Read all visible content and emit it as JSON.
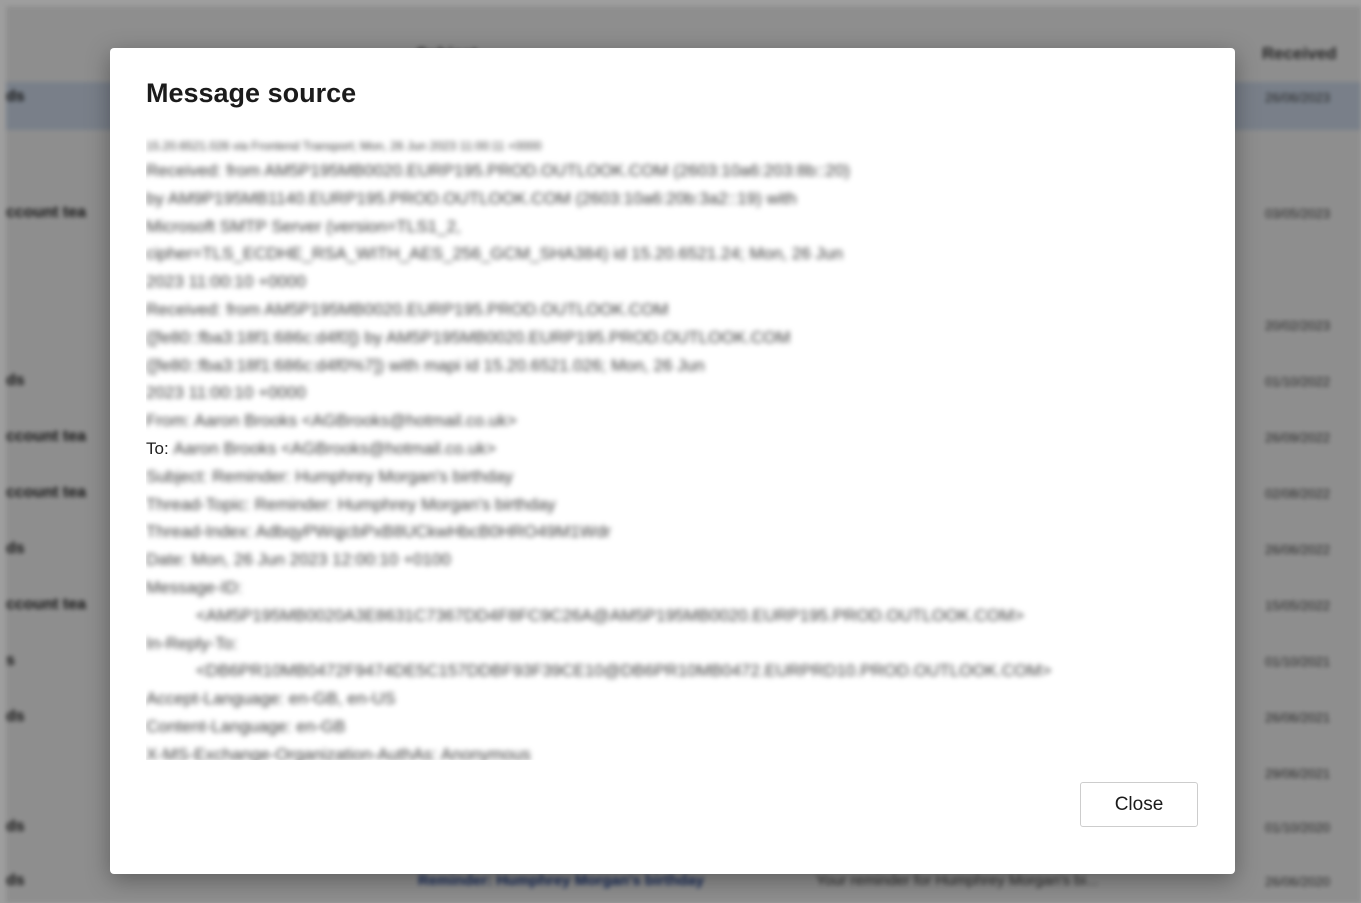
{
  "background": {
    "column_headers": [
      "Subject",
      "Received"
    ],
    "rows": [
      {
        "left": "ds",
        "date": "26/06/2023",
        "selected": true
      },
      {
        "left": "",
        "date": "",
        "selected": false
      },
      {
        "left": "ccount tea",
        "date": "03/05/2023",
        "selected": false
      },
      {
        "left": "",
        "date": "",
        "selected": false
      },
      {
        "left": "",
        "date": "20/02/2023",
        "selected": false
      },
      {
        "left": "ds",
        "date": "01/10/2022",
        "selected": false
      },
      {
        "left": "ccount tea",
        "date": "26/09/2022",
        "selected": false
      },
      {
        "left": "ccount tea",
        "date": "02/08/2022",
        "selected": false
      },
      {
        "left": "ds",
        "date": "26/06/2022",
        "selected": false
      },
      {
        "left": "ccount tea",
        "date": "15/05/2022",
        "selected": false
      },
      {
        "left": "s",
        "date": "01/10/2021",
        "selected": false
      },
      {
        "left": "ds",
        "date": "26/06/2021",
        "selected": false
      },
      {
        "left": "",
        "date": "29/06/2021",
        "selected": false
      },
      {
        "left": "ds",
        "date": "01/10/2020",
        "selected": false
      },
      {
        "left": "ds",
        "date": "26/06/2020",
        "selected": false
      }
    ],
    "bottom_subject": "Reminder: Humphrey Morgan's birthday",
    "bottom_preview": "Your reminder for Humphrey Morgan's bi..."
  },
  "dialog": {
    "title": "Message source",
    "close_label": "Close",
    "source_lines": [
      {
        "text": "15.20.6521.026 via Frontend Transport; Mon, 26 Jun 2023 11:00:11 +0000",
        "blur": true,
        "first": true
      },
      {
        "text": "Received: from AM5P195MB0020.EURP195.PROD.OUTLOOK.COM (2603:10a6:203:8b::20)",
        "blur": true
      },
      {
        "text": " by AM9P195MB1140.EURP195.PROD.OUTLOOK.COM (2603:10a6:20b:3a2::19) with",
        "blur": true
      },
      {
        "text": " Microsoft SMTP Server (version=TLS1_2,",
        "blur": true
      },
      {
        "text": " cipher=TLS_ECDHE_RSA_WITH_AES_256_GCM_SHA384) id 15.20.6521.24; Mon, 26 Jun",
        "blur": true
      },
      {
        "text": " 2023 11:00:10 +0000",
        "blur": true
      },
      {
        "text": "Received: from AM5P195MB0020.EURP195.PROD.OUTLOOK.COM",
        "blur": true
      },
      {
        "text": " ([fe80::fba3:18f1:686c:d4f0]) by AM5P195MB0020.EURP195.PROD.OUTLOOK.COM",
        "blur": true
      },
      {
        "text": " ([fe80::fba3:18f1:686c:d4f0%7]) with mapi id 15.20.6521.026; Mon, 26 Jun",
        "blur": true
      },
      {
        "text": " 2023 11:00:10 +0000",
        "blur": true
      },
      {
        "text": "From: Aaron Brooks <AGBrooks@hotmail.co.uk>",
        "blur": true
      },
      {
        "prefix": "To: ",
        "text": "Aaron Brooks <AGBrooks@hotmail.co.uk>",
        "blur": true
      },
      {
        "text": "Subject: Reminder: Humphrey Morgan's birthday",
        "blur": true
      },
      {
        "text": "Thread-Topic: Reminder: Humphrey Morgan's birthday",
        "blur": true
      },
      {
        "text": "Thread-Index: AdbqyPWqjcbPxB8UCkwHbcB0HRO49M1Wdr",
        "blur": true
      },
      {
        "text": "Date: Mon, 26 Jun 2023 12:00:10 +0100",
        "blur": true
      },
      {
        "text": "Message-ID:",
        "blur": true
      },
      {
        "text": "<AM5P195MB0020A3E8631C7367DD4F8FC9C26A@AM5P195MB0020.EURP195.PROD.OUTLOOK.COM>",
        "blur": true,
        "indent": true
      },
      {
        "text": "In-Reply-To:",
        "blur": true
      },
      {
        "text": "<DB6PR10MB0472F9474DE5C157DDBF93F39CE10@DB6PR10MB0472.EURPRD10.PROD.OUTLOOK.COM>",
        "blur": true,
        "indent": true
      },
      {
        "text": "Accept-Language: en-GB, en-US",
        "blur": true
      },
      {
        "text": "Content-Language: en-GB",
        "blur": true
      },
      {
        "text": "X-MS-Exchange-Organization-AuthAs: Anonymous",
        "blur": true
      }
    ]
  },
  "colors": {
    "selected_row": "#c3cede",
    "overlay": "rgba(0,0,0,0.38)",
    "dialog_bg": "#ffffff"
  }
}
